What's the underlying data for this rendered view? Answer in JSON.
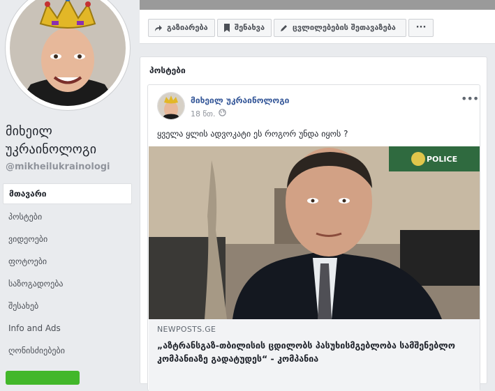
{
  "profile": {
    "name": "მიხეილ უკრაინოლოგი",
    "handle": "@mikheilukrainologi"
  },
  "sidebar": {
    "items": [
      {
        "label": "მთავარი",
        "active": true
      },
      {
        "label": "პოსტები",
        "active": false
      },
      {
        "label": "ვიდეოები",
        "active": false
      },
      {
        "label": "ფოტოები",
        "active": false
      },
      {
        "label": "საზოგადოება",
        "active": false
      },
      {
        "label": "შესახებ",
        "active": false
      },
      {
        "label": "Info and Ads",
        "active": false
      },
      {
        "label": "ღონისძიებები",
        "active": false
      }
    ]
  },
  "actions": {
    "share": "გაზიარება",
    "save": "შენახვა",
    "suggest_edits": "ცვლილებების შეთავაზება",
    "more": "···"
  },
  "posts_section": {
    "title": "პოსტები",
    "post": {
      "author": "მიხეილ უკრაინოლოგი",
      "time": "18 წთ.",
      "text": "ყველა ყლის ადვოკატი ეს როგორ უნდა იყოს ?",
      "more": "•••",
      "image_sign": "POLICE",
      "link": {
        "source": "NEWPOSTS.GE",
        "title": "„აზტრანსგაზ-თბილისის ცდილობს პასუხისმგებლობა სამშენებლო კომპანიაზე გადატუდეს“ - კომპანია"
      }
    }
  },
  "colors": {
    "link_blue": "#365899",
    "page_bg": "#e9ebee",
    "cta_green": "#42b72a"
  }
}
